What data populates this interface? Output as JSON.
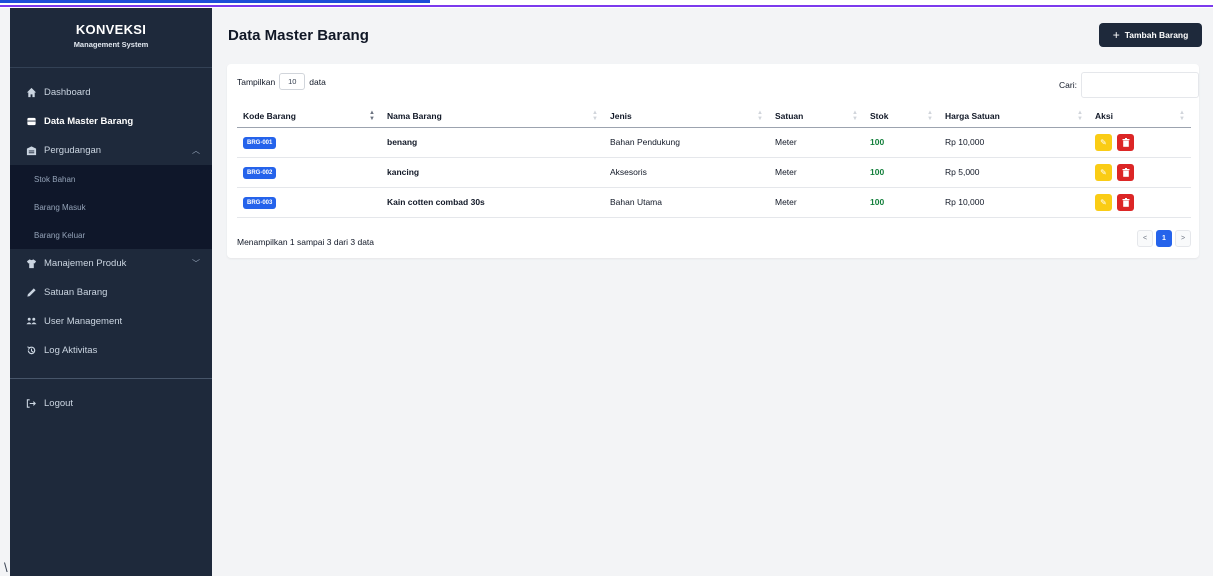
{
  "sidebar": {
    "brand_title": "KONVEKSI",
    "brand_subtitle": "Management System",
    "items": [
      {
        "label": "Dashboard",
        "icon": "home-icon"
      },
      {
        "label": "Data Master Barang",
        "icon": "box-icon",
        "active": true
      },
      {
        "label": "Pergudangan",
        "icon": "warehouse-icon",
        "expanded": true
      },
      {
        "label": "Manajemen Produk",
        "icon": "shirt-icon"
      },
      {
        "label": "Satuan Barang",
        "icon": "pen-icon"
      },
      {
        "label": "User Management",
        "icon": "users-icon"
      },
      {
        "label": "Log Aktivitas",
        "icon": "history-icon"
      }
    ],
    "subitems": [
      "Stok Bahan",
      "Barang Masuk",
      "Barang Keluar"
    ],
    "logout_label": "Logout",
    "stray_char": "\\"
  },
  "header": {
    "title": "Data Master Barang",
    "add_button": "Tambah Barang"
  },
  "table_controls": {
    "show_label": "Tampilkan",
    "page_length": "10",
    "entries_label": "data",
    "search_label": "Cari:"
  },
  "table": {
    "columns": [
      "Kode Barang",
      "Nama Barang",
      "Jenis",
      "Satuan",
      "Stok",
      "Harga Satuan",
      "Aksi"
    ],
    "rows": [
      {
        "kode": "BRG-001",
        "nama": "benang",
        "jenis": "Bahan Pendukung",
        "satuan": "Meter",
        "stok": "100",
        "harga": "Rp 10,000"
      },
      {
        "kode": "BRG-002",
        "nama": "kancing",
        "jenis": "Aksesoris",
        "satuan": "Meter",
        "stok": "100",
        "harga": "Rp 5,000"
      },
      {
        "kode": "BRG-003",
        "nama": "Kain cotten combad 30s",
        "jenis": "Bahan Utama",
        "satuan": "Meter",
        "stok": "100",
        "harga": "Rp 10,000"
      }
    ]
  },
  "footer": {
    "info": "Menampilkan 1 sampai 3 dari 3 data",
    "prev": "<",
    "page": "1",
    "next": ">"
  },
  "colors": {
    "sidebar_bg": "#1e293b",
    "accent": "#2563eb",
    "edit": "#facc15",
    "delete": "#dc2626",
    "stock": "#15803d"
  }
}
